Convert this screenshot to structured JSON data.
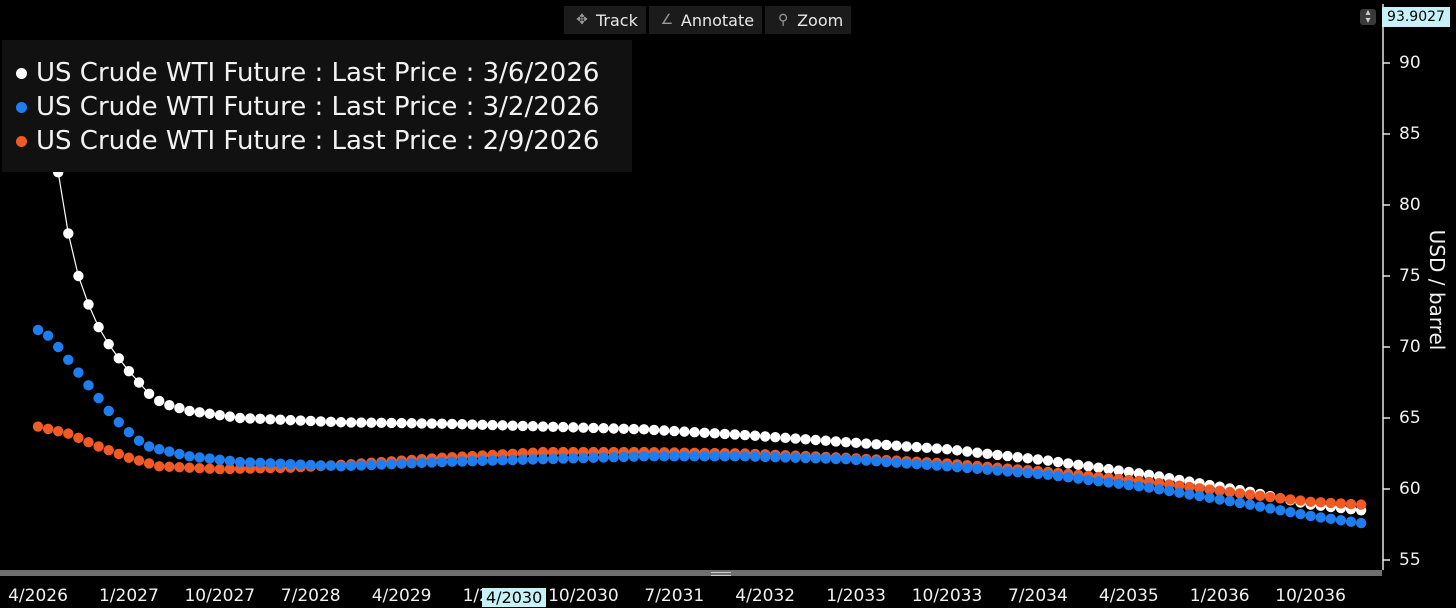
{
  "toolbar": {
    "track_label": "Track",
    "annotate_label": "Annotate",
    "zoom_label": "Zoom"
  },
  "last_price_tag": "93.9027",
  "cursor_label": "4/2030",
  "chart_data": {
    "type": "scatter",
    "ylabel": "USD / barrel",
    "ylim": [
      55,
      92
    ],
    "x_ticks": [
      "4/2026",
      "1/2027",
      "10/2027",
      "7/2028",
      "4/2029",
      "1/2030",
      "10/2030",
      "7/2031",
      "4/2032",
      "1/2033",
      "10/2033",
      "7/2034",
      "4/2035",
      "1/2036",
      "10/2036"
    ],
    "y_ticks": [
      55,
      60,
      65,
      70,
      75,
      80,
      85,
      90
    ],
    "grid": false,
    "legend_position": "top-left",
    "series": [
      {
        "name": "US Crude WTI Future : Last Price : 3/6/2026",
        "color": "#ffffff",
        "anchors": [
          [
            0,
            90.8
          ],
          [
            1,
            88.0
          ],
          [
            2,
            82.3
          ],
          [
            3,
            78.0
          ],
          [
            4,
            75.0
          ],
          [
            5,
            73.0
          ],
          [
            6,
            71.4
          ],
          [
            7,
            70.2
          ],
          [
            8,
            69.2
          ],
          [
            9,
            68.3
          ],
          [
            10,
            67.5
          ],
          [
            11,
            66.7
          ],
          [
            12,
            66.2
          ],
          [
            13,
            65.9
          ],
          [
            15,
            65.5
          ],
          [
            20,
            65.0
          ],
          [
            30,
            64.7
          ],
          [
            40,
            64.6
          ],
          [
            50,
            64.4
          ],
          [
            60,
            64.2
          ],
          [
            70,
            63.8
          ],
          [
            80,
            63.3
          ],
          [
            90,
            62.8
          ],
          [
            100,
            62.0
          ],
          [
            110,
            61.0
          ],
          [
            120,
            59.8
          ],
          [
            126,
            58.9
          ],
          [
            131,
            58.5
          ]
        ]
      },
      {
        "name": "US Crude WTI Future : Last Price : 3/2/2026",
        "color": "#1e7ef0",
        "anchors": [
          [
            0,
            71.2
          ],
          [
            1,
            70.8
          ],
          [
            2,
            70.0
          ],
          [
            3,
            69.1
          ],
          [
            4,
            68.2
          ],
          [
            5,
            67.3
          ],
          [
            6,
            66.4
          ],
          [
            7,
            65.5
          ],
          [
            8,
            64.7
          ],
          [
            9,
            64.0
          ],
          [
            10,
            63.4
          ],
          [
            11,
            63.0
          ],
          [
            12,
            62.8
          ],
          [
            15,
            62.3
          ],
          [
            20,
            61.9
          ],
          [
            30,
            61.6
          ],
          [
            40,
            61.9
          ],
          [
            50,
            62.1
          ],
          [
            60,
            62.3
          ],
          [
            70,
            62.3
          ],
          [
            80,
            62.1
          ],
          [
            90,
            61.6
          ],
          [
            100,
            61.0
          ],
          [
            110,
            60.1
          ],
          [
            120,
            58.9
          ],
          [
            126,
            58.1
          ],
          [
            131,
            57.6
          ]
        ]
      },
      {
        "name": "US Crude WTI Future : Last Price : 2/9/2026",
        "color": "#f15a24",
        "anchors": [
          [
            0,
            64.4
          ],
          [
            3,
            63.9
          ],
          [
            6,
            63.0
          ],
          [
            9,
            62.2
          ],
          [
            12,
            61.6
          ],
          [
            18,
            61.4
          ],
          [
            25,
            61.5
          ],
          [
            30,
            61.7
          ],
          [
            40,
            62.2
          ],
          [
            50,
            62.6
          ],
          [
            60,
            62.6
          ],
          [
            70,
            62.5
          ],
          [
            80,
            62.2
          ],
          [
            90,
            61.8
          ],
          [
            100,
            61.2
          ],
          [
            110,
            60.5
          ],
          [
            120,
            59.6
          ],
          [
            126,
            59.1
          ],
          [
            131,
            58.9
          ]
        ]
      }
    ]
  }
}
